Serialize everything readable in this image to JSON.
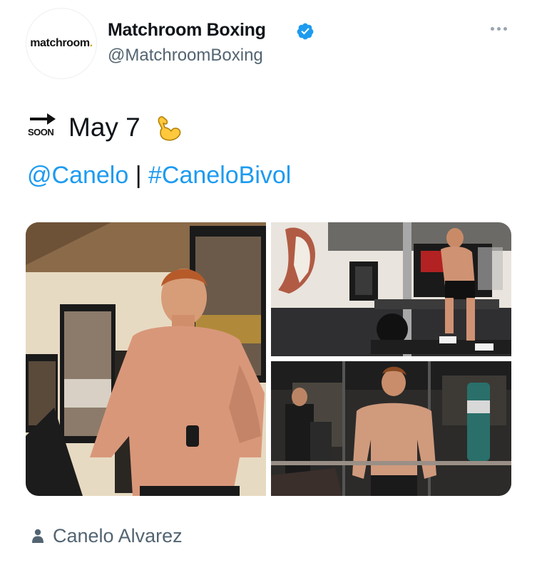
{
  "tweet": {
    "avatar_text": "matchroom",
    "avatar_dot": ".",
    "display_name": "Matchroom Boxing",
    "handle": "@MatchroomBoxing",
    "verified": true,
    "text_line1": "May 7",
    "soon_label": "SOON",
    "emoji_line1": [
      "soon-arrow-icon",
      "flexed-biceps-icon"
    ],
    "mention": "@Canelo",
    "separator": " | ",
    "hashtag": "#CaneloBivol",
    "tagged_person": "Canelo Alvarez"
  },
  "media": {
    "count": 3,
    "photos": [
      {
        "name": "boxer-shirtless-with-posters"
      },
      {
        "name": "boxer-on-treadmill-gym"
      },
      {
        "name": "boxer-in-training-gym"
      }
    ]
  },
  "colors": {
    "link": "#1d9bf0",
    "secondary_text": "#536471",
    "verified_badge": "#1d9bf0",
    "avatar_dot": "#d4a017"
  }
}
